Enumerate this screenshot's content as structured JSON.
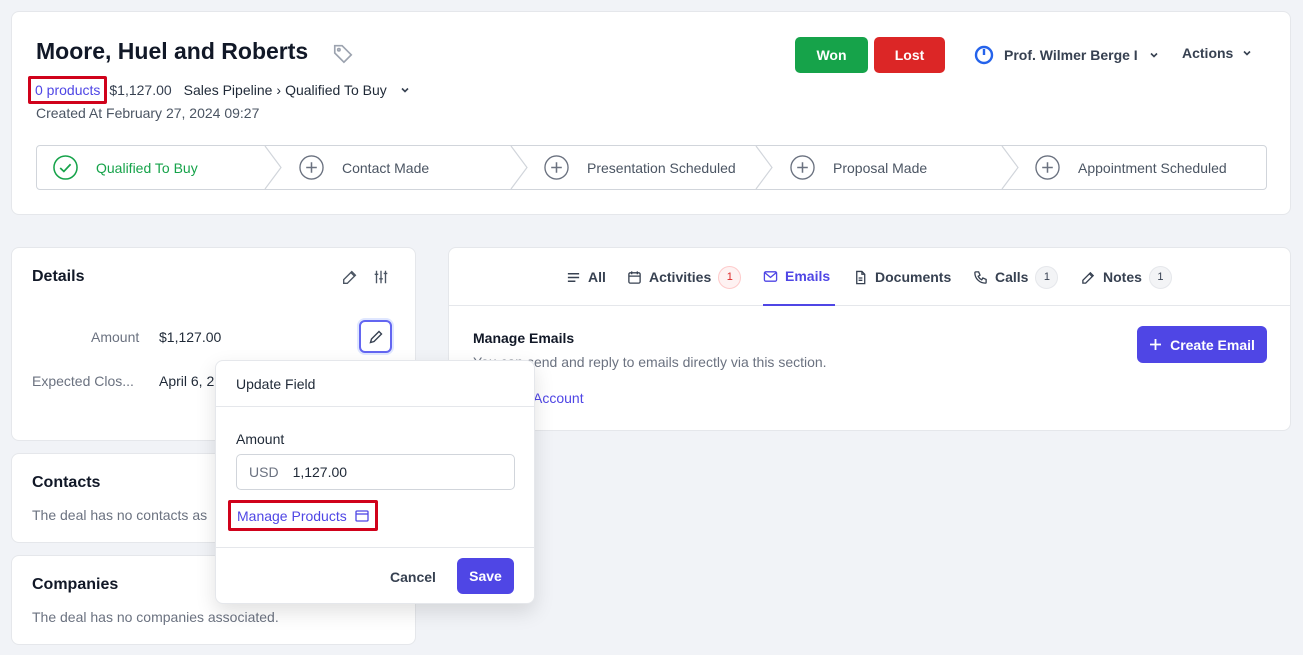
{
  "deal": {
    "title": "Moore, Huel and Roberts",
    "products_link": "0 products",
    "amount": "$1,127.00",
    "pipeline": "Sales Pipeline",
    "stage": "Qualified To Buy",
    "created": "Created At February 27, 2024 09:27"
  },
  "header": {
    "won_label": "Won",
    "lost_label": "Lost",
    "owner": "Prof. Wilmer Berge I",
    "actions_label": "Actions"
  },
  "stages": [
    {
      "label": "Qualified To Buy",
      "status": "done"
    },
    {
      "label": "Contact Made",
      "status": "pending"
    },
    {
      "label": "Presentation Scheduled",
      "status": "pending"
    },
    {
      "label": "Proposal Made",
      "status": "pending"
    },
    {
      "label": "Appointment Scheduled",
      "status": "pending"
    }
  ],
  "details": {
    "title": "Details",
    "fields": [
      {
        "label": "Amount",
        "value": "$1,127.00"
      },
      {
        "label": "Expected Clos...",
        "value": "April 6, 2"
      }
    ]
  },
  "contacts": {
    "title": "Contacts",
    "empty": "The deal has no contacts as"
  },
  "companies": {
    "title": "Companies",
    "empty": "The deal has no companies associated."
  },
  "tabs": [
    {
      "label": "All",
      "icon": "list-icon"
    },
    {
      "label": "Activities",
      "icon": "calendar-icon",
      "badge": "1"
    },
    {
      "label": "Emails",
      "icon": "mail-icon",
      "active": true
    },
    {
      "label": "Documents",
      "icon": "document-icon"
    },
    {
      "label": "Calls",
      "icon": "phone-icon",
      "badge": "1"
    },
    {
      "label": "Notes",
      "icon": "note-icon",
      "badge": "1"
    }
  ],
  "emails": {
    "title": "Manage Emails",
    "subtitle": "You can send and reply to emails directly via this section.",
    "account_link": "Account",
    "create_label": "Create Email"
  },
  "popover": {
    "title": "Update Field",
    "field_label": "Amount",
    "currency": "USD",
    "value": "1,127.00",
    "manage_products": "Manage Products",
    "cancel_label": "Cancel",
    "save_label": "Save"
  },
  "colors": {
    "accent": "#4f46e5",
    "won": "#16a34a",
    "lost": "#dc2626",
    "highlight": "#d0021b"
  }
}
